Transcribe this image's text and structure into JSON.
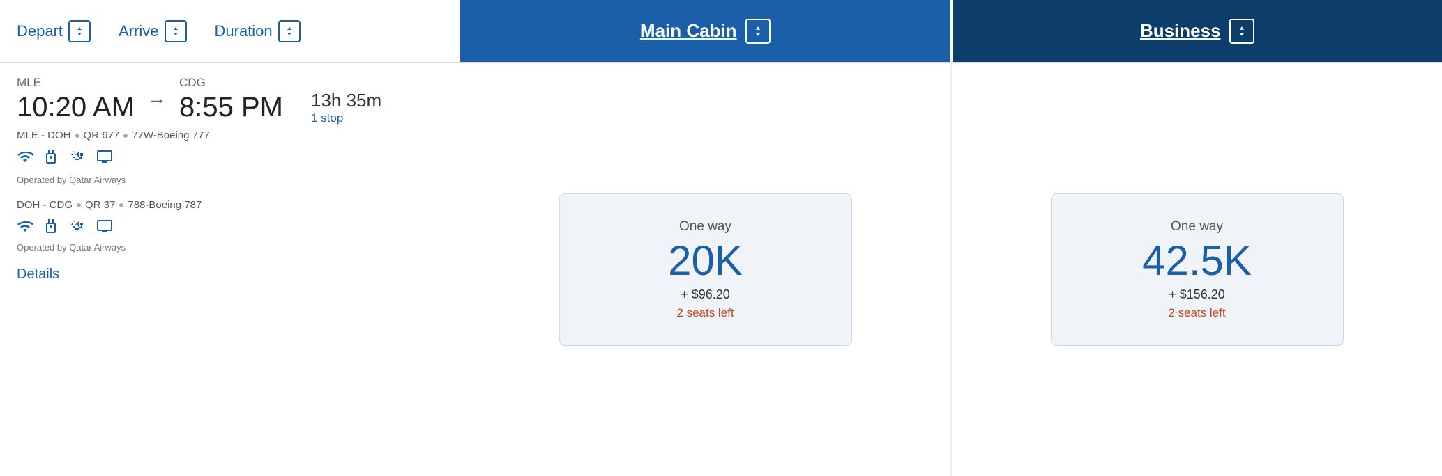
{
  "header": {
    "depart_label": "Depart",
    "arrive_label": "Arrive",
    "duration_label": "Duration",
    "main_cabin_label": "Main Cabin",
    "business_label": "Business"
  },
  "flight": {
    "depart_code": "MLE",
    "depart_time": "10:20 AM",
    "arrive_code": "CDG",
    "arrive_time": "8:55 PM",
    "duration": "13h 35m",
    "stops": "1 stop",
    "segment1_route": "MLE - DOH",
    "segment1_flight": "QR 677",
    "segment1_aircraft": "77W-Boeing 777",
    "segment1_operated": "Operated by Qatar Airways",
    "segment2_route": "DOH - CDG",
    "segment2_flight": "QR 37",
    "segment2_aircraft": "788-Boeing 787",
    "segment2_operated": "Operated by Qatar Airways",
    "details_label": "Details"
  },
  "main_cabin": {
    "label": "One way",
    "price": "20K",
    "fees": "+ $96.20",
    "seats": "2 seats left"
  },
  "business": {
    "label": "One way",
    "price": "42.5K",
    "fees": "+ $156.20",
    "seats": "2 seats left"
  },
  "colors": {
    "main_cabin_bg": "#1a5fa8",
    "business_bg": "#0d3d6b",
    "blue": "#1a5fa8",
    "orange_red": "#c8421b",
    "card_bg": "#f0f4f9"
  },
  "icons": {
    "sort_arrows": "⬆⬇",
    "wifi": "📶",
    "power": "🔌",
    "usb": "🔌",
    "entertainment": "🎬"
  }
}
